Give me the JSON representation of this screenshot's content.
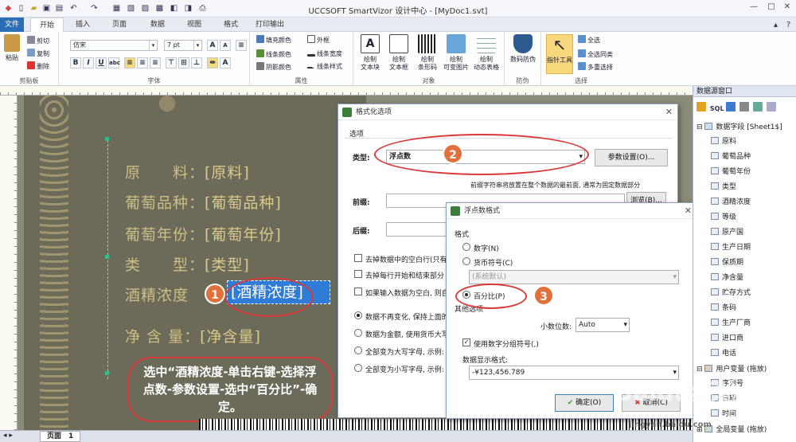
{
  "window": {
    "title": "UCCSOFT SmartVizor 设计中心 - [MyDoc1.svt]"
  },
  "tabs": [
    {
      "label": "文件"
    },
    {
      "label": "开始"
    },
    {
      "label": "插入"
    },
    {
      "label": "页面"
    },
    {
      "label": "数据"
    },
    {
      "label": "视图"
    },
    {
      "label": "格式"
    },
    {
      "label": "打印输出"
    }
  ],
  "ribbon": {
    "clipboard": {
      "paste": "粘贴",
      "cut": "剪切",
      "copy": "复制",
      "delete": "删除",
      "group": "剪贴板"
    },
    "font": {
      "name": "仿宋",
      "size": "7 pt",
      "group": "字体"
    },
    "attributes": {
      "fill_color": "填充颜色",
      "line_color": "线条颜色",
      "shadow_color": "阴影颜色",
      "frame": "外框",
      "line_width": "线条宽度",
      "line_style": "线条样式",
      "group": "属性"
    },
    "objects": {
      "items": [
        "绘制\n文本块",
        "绘制\n文本框",
        "绘制\n条形码",
        "绘制\n可变图片",
        "绘制\n动态表格"
      ],
      "group": "对象"
    },
    "protect": {
      "label": "数码防伪",
      "group": "防伪"
    },
    "select": {
      "tool": "指针工具",
      "select_all": "全选",
      "select_same": "全选同类",
      "multi_select": "多重选择",
      "group": "选择"
    }
  },
  "label": {
    "rows": [
      {
        "name": "原　　料：",
        "field": "[原料]"
      },
      {
        "name": "葡萄品种：",
        "field": "[葡萄品种]"
      },
      {
        "name": "葡萄年份：",
        "field": "[葡萄年份]"
      },
      {
        "name": "类　　型：",
        "field": "[类型]"
      },
      {
        "name": "酒精浓度",
        "field": "[酒精浓度]"
      },
      {
        "name": "净 含 量：",
        "field": "[净含量]"
      }
    ],
    "instruction": "选中“酒精浓度-单击右键-选择浮点数-参数设置-选中“百分比”-确定。"
  },
  "dialog_format": {
    "title": "格式化选项",
    "section": "选项",
    "type_label": "类型:",
    "type_value": "浮点数",
    "param_button": "参数设置(O)...",
    "desc": "前缀字符串将放置在整个数据的最前面, 通常为固定数据部分",
    "prefix_label": "前缀:",
    "suffix_label": "后缀:",
    "browse_button": "浏览(B)...",
    "checks": [
      "去掉数据中的空白行(只有",
      "去掉每行开始和结束部分",
      "如果输入数据为空白, 则自"
    ],
    "radios": [
      "数据不再变化, 保持上面的",
      "数据为金额, 使用货币大写",
      "全部变为大写字母, 示例:",
      "全部变为小写字母, 示例:"
    ]
  },
  "dialog_float": {
    "title": "浮点数格式",
    "format_label": "格式",
    "radio_number": "数字(N)",
    "radio_currency": "货币符号(C)",
    "currency_default": "(系统默认)",
    "radio_percent": "百分比(P)",
    "other_label": "其他选项",
    "decimals_label": "小数位数:",
    "decimals_value": "Auto",
    "group_symbol": "使用数字分组符号(,)",
    "display_label": "数据显示格式:",
    "display_value": "-¥123,456.789",
    "ok": "确定(O)",
    "cancel": "取消(C)"
  },
  "badges": [
    "1",
    "2",
    "3"
  ],
  "right_panel": {
    "title": "数据源窗口",
    "root": "数据字段 [Sheet1$]",
    "fields": [
      "原料",
      "葡萄品种",
      "葡萄年份",
      "类型",
      "酒精浓度",
      "等级",
      "原产国",
      "生产日期",
      "保质期",
      "净含量",
      "贮存方式",
      "条码",
      "生产厂商",
      "进口商",
      "电话"
    ],
    "user_vars": "用户变量 (拖放)",
    "user_items": [
      "序列号",
      "日期",
      "时间"
    ],
    "global_vars": "全局变量 (拖放)"
  },
  "status": {
    "page_tab": "页面",
    "page_num": "1"
  },
  "watermark": {
    "brand": "Baidu经验",
    "url": "jingyan.baidu.com"
  }
}
